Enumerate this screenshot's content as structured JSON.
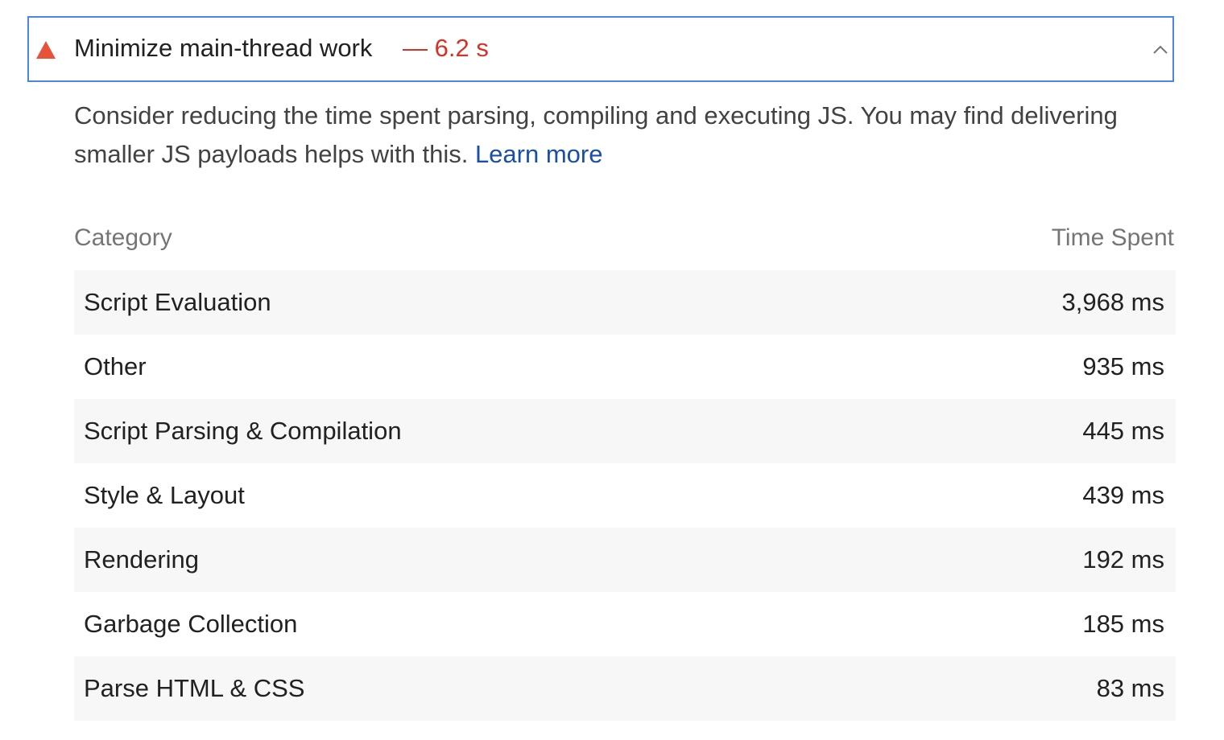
{
  "audit": {
    "title": "Minimize main-thread work",
    "value": "— 6.2 s",
    "status_icon": "warning-triangle-icon",
    "expand_icon": "chevron-up-icon",
    "colors": {
      "warning": "#e8523a",
      "value": "#d93025",
      "link": "#1a4fa8",
      "focus_border": "#4a86e8"
    }
  },
  "description": {
    "text": "Consider reducing the time spent parsing, compiling and executing JS. You may find delivering smaller JS payloads helps with this. ",
    "link_label": "Learn more"
  },
  "table": {
    "headers": {
      "category": "Category",
      "time_spent": "Time Spent"
    },
    "rows": [
      {
        "category": "Script Evaluation",
        "time": "3,968 ms"
      },
      {
        "category": "Other",
        "time": "935 ms"
      },
      {
        "category": "Script Parsing & Compilation",
        "time": "445 ms"
      },
      {
        "category": "Style & Layout",
        "time": "439 ms"
      },
      {
        "category": "Rendering",
        "time": "192 ms"
      },
      {
        "category": "Garbage Collection",
        "time": "185 ms"
      },
      {
        "category": "Parse HTML & CSS",
        "time": "83 ms"
      }
    ]
  }
}
